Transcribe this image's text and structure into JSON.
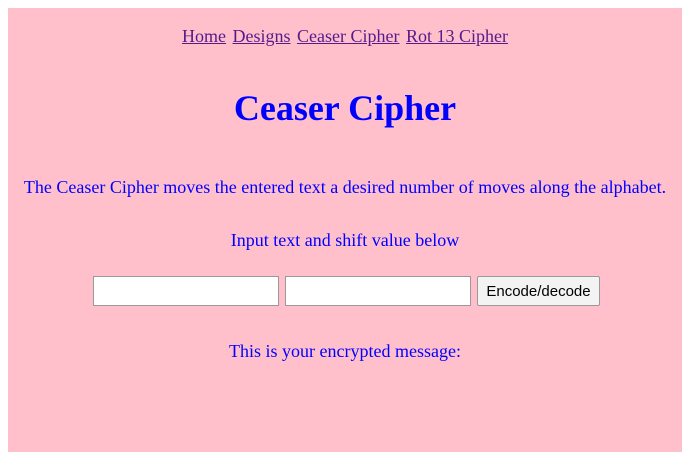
{
  "nav": {
    "links": [
      "Home",
      "Designs",
      "Ceaser Cipher",
      "Rot 13 Cipher"
    ]
  },
  "title": "Ceaser Cipher",
  "description": "The Ceaser Cipher moves the entered text a desired number of moves along the alphabet.",
  "instruction": "Input text and shift value below",
  "form": {
    "text_input_value": "",
    "shift_input_value": "",
    "button_label": "Encode/decode"
  },
  "result_label": "This is your encrypted message:",
  "colors": {
    "background": "#ffc0cb",
    "text": "#0000ff",
    "visited_link": "#551a8b"
  }
}
